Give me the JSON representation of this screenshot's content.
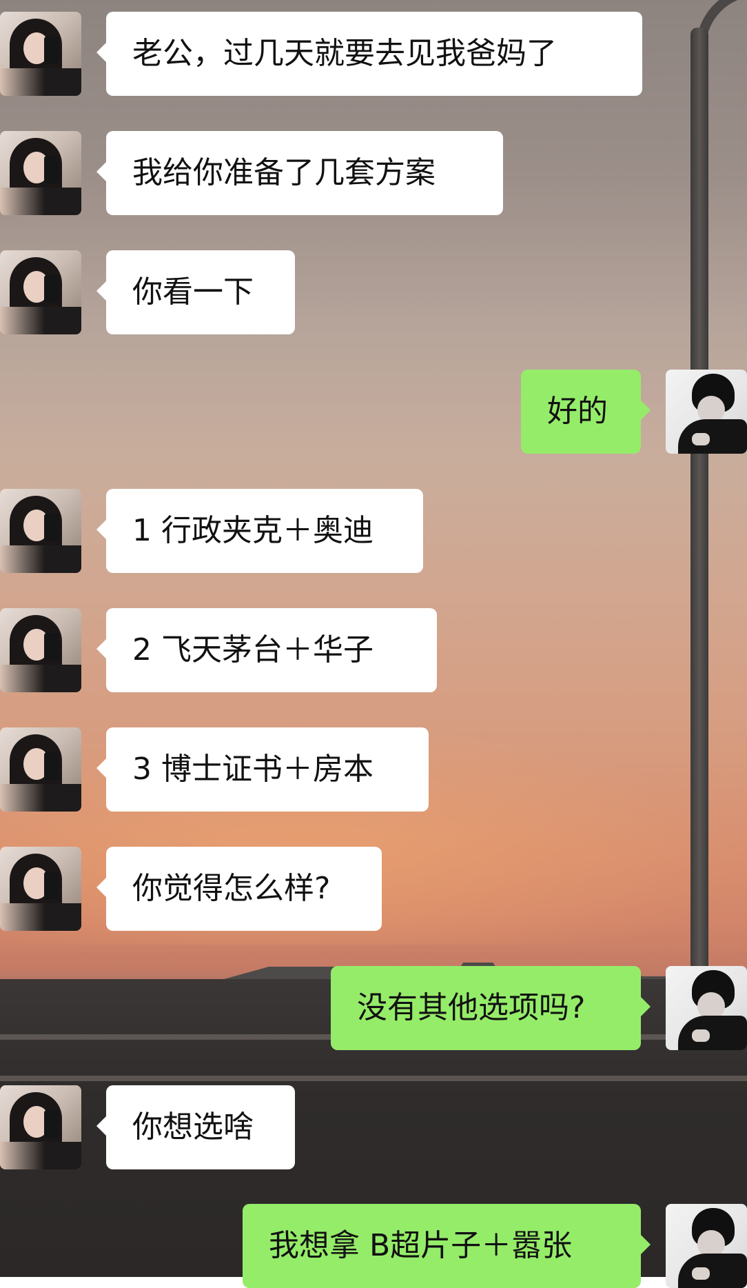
{
  "conversation": {
    "messages": [
      {
        "side": "left",
        "avatar": "her-avatar",
        "text": "老公，过几天就要去见我爸妈了"
      },
      {
        "side": "left",
        "avatar": "her-avatar",
        "text": "我给你准备了几套方案"
      },
      {
        "side": "left",
        "avatar": "her-avatar",
        "text": "你看一下"
      },
      {
        "side": "right",
        "avatar": "his-avatar",
        "text": "好的"
      },
      {
        "side": "left",
        "avatar": "her-avatar",
        "text": "1 行政夹克＋奥迪"
      },
      {
        "side": "left",
        "avatar": "her-avatar",
        "text": "2  飞天茅台＋华子"
      },
      {
        "side": "left",
        "avatar": "her-avatar",
        "text": "3 博士证书＋房本"
      },
      {
        "side": "left",
        "avatar": "her-avatar",
        "text": "你觉得怎么样?"
      },
      {
        "side": "right",
        "avatar": "his-avatar",
        "text": "没有其他选项吗?"
      },
      {
        "side": "left",
        "avatar": "her-avatar",
        "text": "你想选啥"
      },
      {
        "side": "right",
        "avatar": "his-avatar",
        "text": "我想拿  B超片子＋嚣张"
      }
    ]
  },
  "colors": {
    "incoming_bubble": "#ffffff",
    "outgoing_bubble": "#95ec69",
    "text": "#111111"
  }
}
